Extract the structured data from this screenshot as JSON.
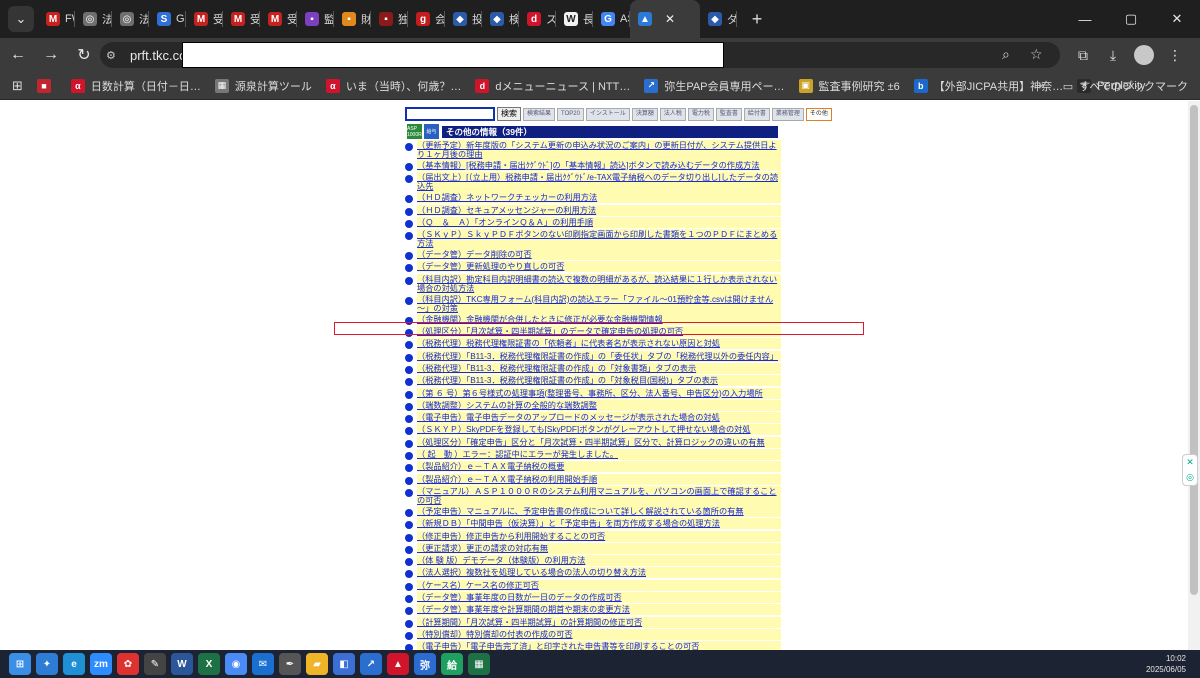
{
  "browser": {
    "tabs": [
      {
        "label": "FW:",
        "icon": "gmail-icon",
        "color": "#c5221f",
        "glyph": "M"
      },
      {
        "label": "法人",
        "icon": "globe-icon",
        "color": "#6f6f6f",
        "glyph": "◎"
      },
      {
        "label": "法人",
        "icon": "globe-icon",
        "color": "#6f6f6f",
        "glyph": "◎"
      },
      {
        "label": "Goo",
        "icon": "sheets-icon",
        "color": "#2f6fd6",
        "glyph": "S"
      },
      {
        "label": "受信",
        "icon": "gmail-icon",
        "color": "#c5221f",
        "glyph": "M"
      },
      {
        "label": "受信",
        "icon": "gmail-icon",
        "color": "#c5221f",
        "glyph": "M"
      },
      {
        "label": "受信",
        "icon": "gmail-icon",
        "color": "#c5221f",
        "glyph": "M"
      },
      {
        "label": "監査",
        "icon": "app-icon",
        "color": "#7c3fbf",
        "glyph": "▪"
      },
      {
        "label": "財務",
        "icon": "app-icon",
        "color": "#e08a1e",
        "glyph": "▪"
      },
      {
        "label": "独立",
        "icon": "doc-icon",
        "color": "#8b1a1a",
        "glyph": "▪"
      },
      {
        "label": "会計",
        "icon": "g-icon",
        "color": "#c41d1d",
        "glyph": "g"
      },
      {
        "label": "投稿",
        "icon": "shield-icon",
        "color": "#2b5aa8",
        "glyph": "◆"
      },
      {
        "label": "検索",
        "icon": "shield-icon",
        "color": "#2b5aa8",
        "glyph": "◆"
      },
      {
        "label": "スポ",
        "icon": "d-icon",
        "color": "#d0142c",
        "glyph": "d"
      },
      {
        "label": "長和",
        "icon": "w-icon",
        "color": "#f2f2f2",
        "glyph": "W"
      },
      {
        "label": "ASP",
        "icon": "google-icon",
        "color": "#4285f4",
        "glyph": "G"
      },
      {
        "label": "",
        "icon": "tkc-icon",
        "color": "#2b7bd6",
        "glyph": "▲",
        "active": true
      },
      {
        "label": "ダッ",
        "icon": "shield-icon",
        "color": "#2b5aa8",
        "glyph": "◆"
      }
    ],
    "url": "prft.tkc.co",
    "window_controls": [
      "—",
      "▢",
      "✕"
    ]
  },
  "bookmarks": {
    "items": [
      {
        "label": "",
        "icon": "bookmark-app-icon",
        "color": "#c0262d",
        "glyph": "■"
      },
      {
        "label": "日数計算（日付－日…",
        "icon": "alpha-icon",
        "color": "#d0142c",
        "glyph": "α"
      },
      {
        "label": "源泉計算ツール",
        "icon": "grid-icon",
        "color": "#777777",
        "glyph": "▦"
      },
      {
        "label": "いま（当時）、何歳？…",
        "icon": "alpha-icon",
        "color": "#d0142c",
        "glyph": "α"
      },
      {
        "label": "dメニューニュース | NTT…",
        "icon": "d-icon",
        "color": "#d0142c",
        "glyph": "d"
      },
      {
        "label": "弥生PAP会員専用ペー…",
        "icon": "arrow-icon",
        "color": "#2a6fd0",
        "glyph": "↗"
      },
      {
        "label": "監査事例研究 ±6",
        "icon": "image-icon",
        "color": "#c9a227",
        "glyph": "▣"
      },
      {
        "label": "【外部JICPA共用】神奈…",
        "icon": "box-icon",
        "color": "#1b6ac9",
        "glyph": "b"
      },
      {
        "label": "Perplexity",
        "icon": "perplexity-icon",
        "color": "#2b2b2b",
        "glyph": "✳"
      }
    ],
    "more": "»",
    "all_bookmarks": "すべてのブックマーク"
  },
  "page": {
    "search_button": "検索",
    "nav_tabs": [
      "検索結果",
      "TOP20",
      "インストール",
      "決算額",
      "法人税",
      "電力税",
      "監査書",
      "給付書",
      "業務管理",
      "その他"
    ],
    "section_title": "その他の情報（39件）",
    "logo_asp": "ASP 1000R",
    "logo_kyu": "給与",
    "items": [
      "（更新予定）新年度版の「システム更新の申込み状況のご案内」の更新日付が、システム提供日より１ヶ月後の理由",
      "（基本情報）[税務申請・届出ｸｸﾞｳﾄﾞ]の「基本情報」読込]ボタンで読み込むデータの作成方法",
      "（届出文上）[（立上用）税務申請・届出ｸｸﾞｳﾄﾞ/e-TAX電子納税へのデータ切り出し]したデータの読込先",
      "（ＨＤ調査）ネットワークチェッカーの利用方法",
      "（ＨＤ調査）セキュアメッセンジャーの利用方法",
      "（Ｑ　＆　Ａ）「オンラインＱ＆Ａ」の利用手順",
      "（ＳＫｙＰ）ＳｋｙＰＤＦボタンのない印刷指定画面から印刷した書類を１つのＰＤＦにまとめる方法",
      "（データ管）データ削除の可否",
      "（データ管）更新処理のやり直しの可否",
      "（科目内訳）勘定科目内訳明細書の読込で複数の明細があるが、読込結果に１行しか表示されない場合の対処方法",
      "（科目内訳）TKC専用フォーム(科目内訳)の読込エラー「ファイル～01預貯金等.csvは開けません～」の対策",
      "（金融機関）金融機関が合併したときに修正が必要な金融機関情報",
      "（処理区分）「月次試算・四半期試算」のデータで確定申告の処理の可否",
      "（税務代理）税務代理権限証書の「依頼者」に代表者名が表示されない原因と対処",
      "（税務代理）「B11-3．税務代理権限証書の作成」の「委任状」タブの「税務代理以外の委任内容」",
      "（税務代理）「B11-3．税務代理権限証書の作成」の「対象書類」タブの表示",
      "（税務代理）「B11-3．税務代理権限証書の作成」の「対象税目(国税)」タブの表示",
      "（第 ６ 号）第６号様式の処理事項(整理番号、事務所、区分、法人番号、申告区分)の入力場所",
      "（端数調整）システムの計算の全般的な端数調整",
      "（電子申告）電子申告データのアップロードのメッセージが表示された場合の対処",
      "（ＳＫＹＰ）SkyPDFを登録しても[SkyPDF]ボタンがグレーアウトして押せない場合の対処",
      "（処理区分）「確定申告」区分と「月次試算・四半期試算」区分で、計算ロジックの違いの有無",
      "（ 起　動 ）エラー：認証中にエラーが発生しました。",
      "（製品紹介）ｅ－ＴＡＸ電子納税の概要",
      "（製品紹介）ｅ－ＴＡＸ電子納税の利用開始手順",
      "（マニュアル）ＡＳＰ１０００Ｒのシステム利用マニュアルを、パソコンの画面上で確認することの可否",
      "（予定申告）マニュアルに、予定申告書の作成について詳しく解説されている箇所の有無",
      "（新規ＤＢ）「中間申告（仮決算）」と「予定申告」を両方作成する場合の処理方法",
      "（修正申告）修正申告から利用開始することの可否",
      "（更正請求）更正の請求の対応有無",
      "（体 験 版）デモデータ（体験版）の利用方法",
      "（法人選択）複数社を処理している場合の法人の切り替え方法",
      "（ケース名）ケース名の修正可否",
      "（データ管）事業年度の日数が一日のデータの作成可否",
      "（データ管）事業年度や計算期間の期首や期末の変更方法",
      "（計算期間）「月次試算・四半期試算」の計算期間の修正可否",
      "（特別償却）特別償却の付表の作成の可否",
      "（電子申告）「電子申告完了済」と印字された申告書等を印刷することの可否"
    ]
  },
  "taskbar": {
    "apps": [
      {
        "icon": "windows-start-icon",
        "color": "#3a8ee6",
        "glyph": "⊞"
      },
      {
        "icon": "copilot-icon",
        "color": "#2f7cd6",
        "glyph": "✦"
      },
      {
        "icon": "edge-icon",
        "color": "#1f8fd6",
        "glyph": "e"
      },
      {
        "icon": "zoom-icon",
        "color": "#2d8cff",
        "glyph": "zm"
      },
      {
        "icon": "settings-app-icon",
        "color": "#e03131",
        "glyph": "✿"
      },
      {
        "icon": "pen-app-icon",
        "color": "#444444",
        "glyph": "✎"
      },
      {
        "icon": "word-icon",
        "color": "#2b579a",
        "glyph": "W"
      },
      {
        "icon": "excel-icon",
        "color": "#1e7145",
        "glyph": "X"
      },
      {
        "icon": "chrome-icon",
        "color": "#4a8bf5",
        "glyph": "◉"
      },
      {
        "icon": "mail-icon",
        "color": "#1a6fd0",
        "glyph": "✉"
      },
      {
        "icon": "pen-app-icon",
        "color": "#555555",
        "glyph": "✒"
      },
      {
        "icon": "explorer-icon",
        "color": "#f0b429",
        "glyph": "▰"
      },
      {
        "icon": "app-icon",
        "color": "#3b6fd6",
        "glyph": "◧"
      },
      {
        "icon": "arrow-icon",
        "color": "#2a6fd0",
        "glyph": "↗"
      },
      {
        "icon": "acrobat-icon",
        "color": "#d0142c",
        "glyph": "▲"
      },
      {
        "icon": "yayoi-icon",
        "color": "#2b6cd0",
        "glyph": "弥"
      },
      {
        "icon": "yayoi-icon",
        "color": "#20a060",
        "glyph": "給"
      },
      {
        "icon": "excel-icon",
        "color": "#1e7145",
        "glyph": "▦"
      }
    ],
    "time": "10:02",
    "date": "2025/06/05"
  },
  "highlight_index": 13
}
